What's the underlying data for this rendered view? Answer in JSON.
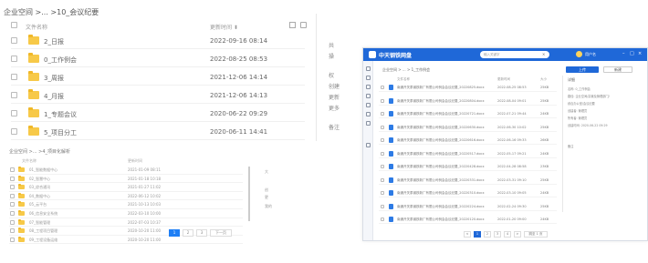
{
  "main": {
    "breadcrumb": "企业空间 >... >10_会议纪要",
    "header": {
      "name": "文件名称",
      "time": "更新时间 ⬍"
    },
    "rows": [
      {
        "name": "2_日报",
        "time": "2022-09-16 08:14"
      },
      {
        "name": "0_工作例会",
        "time": "2022-08-25 08:53"
      },
      {
        "name": "3_周报",
        "time": "2021-12-06 14:14"
      },
      {
        "name": "4_月报",
        "time": "2021-12-06 14:13"
      },
      {
        "name": "1_专题会议",
        "time": "2020-06-22 09:29"
      },
      {
        "name": "5_项目分工",
        "time": "2020-06-11 14:41"
      }
    ],
    "side": [
      "共",
      "操",
      "权",
      "创建",
      "更新",
      "更多",
      "备注"
    ]
  },
  "small": {
    "breadcrumb": "企业空间 >... >4_项目化解析",
    "header": {
      "name": "文件名称",
      "time": "更新时间"
    },
    "rows": [
      {
        "name": "01_智能数据中心",
        "time": "2021-01-09 08:11"
      },
      {
        "name": "02_智慧中心",
        "time": "2021-01-18 10:18"
      },
      {
        "name": "03_综合通讯",
        "time": "2021-01-27 11:02"
      },
      {
        "name": "04_数据中心",
        "time": "2022-06-12 10:02"
      },
      {
        "name": "05_云平台",
        "time": "2021-10-13 10:03"
      },
      {
        "name": "06_信息安全系统",
        "time": "2022-03-10 10:00"
      },
      {
        "name": "07_智能管理",
        "time": "2022-07-03 10:37"
      },
      {
        "name": "08_工程项目管理",
        "time": "2020-10-20 11:00"
      },
      {
        "name": "09_工程设备运维",
        "time": "2020-10-20 11:00"
      }
    ],
    "side": [
      "大",
      "创",
      "更",
      "我的"
    ],
    "pager": {
      "pages": [
        "1",
        "2",
        "3"
      ],
      "next": "下一页"
    }
  },
  "window": {
    "title": "中天钢铁网盘",
    "search_placeholder": "输入关键字",
    "username": "用户名",
    "breadcrumb": "企业空间 > ... > 1_工作例会",
    "upload_label": "上传",
    "new_label": "新建",
    "header": {
      "name": "文件名称",
      "time": "更新时间",
      "size": "大小"
    },
    "files": [
      {
        "name": "南通开关泰钢铁新厂有限公司例会会议纪要_20220825.docx",
        "time": "2022-08-25 08:53",
        "size": "25KB"
      },
      {
        "name": "南通开关泰钢铁新厂有限公司例会会议纪要_20220804.docx",
        "time": "2022-08-04 09:01",
        "size": "25KB"
      },
      {
        "name": "南通开关泰钢铁新厂有限公司例会会议纪要_20220721.docx",
        "time": "2022-07-21 09:44",
        "size": "24KB"
      },
      {
        "name": "南通开关泰钢铁新厂有限公司例会会议纪要_20220630.docx",
        "time": "2022-06-30 10:02",
        "size": "25KB"
      },
      {
        "name": "南通开关泰钢铁新厂有限公司例会会议纪要_20220616.docx",
        "time": "2022-06-16 09:33",
        "size": "26KB"
      },
      {
        "name": "南通开关泰钢铁新厂有限公司例会会议纪要_20220517.docx",
        "time": "2022-05-17 09:21",
        "size": "24KB"
      },
      {
        "name": "南通开关泰钢铁新厂有限公司例会会议纪要_20220428.docx",
        "time": "2022-04-28 08:58",
        "size": "23KB"
      },
      {
        "name": "南通开关泰钢铁新厂有限公司例会会议纪要_20220331.docx",
        "time": "2022-03-31 09:10",
        "size": "25KB"
      },
      {
        "name": "南通开关泰钢铁新厂有限公司例会会议纪要_20220310.docx",
        "time": "2022-03-10 09:05",
        "size": "24KB"
      },
      {
        "name": "南通开关泰钢铁新厂有限公司例会会议纪要_20220224.docx",
        "time": "2022-02-24 09:30",
        "size": "25KB"
      },
      {
        "name": "南通开关泰钢铁新厂有限公司例会会议纪要_20220120.docx",
        "time": "2022-01-20 09:00",
        "size": "24KB"
      }
    ],
    "details": {
      "title": "详细",
      "lines": [
        "名称: 0_工作例会",
        "路径: 企业空间/高管及管理部门/",
        "     综合办公室/会议纪要",
        "创建者: 管理员",
        "所有者: 管理员",
        "创建时间: 2020-06-22 09:29"
      ],
      "remark": "备注"
    },
    "pager": {
      "prev": "<",
      "pages": [
        "1",
        "2",
        "3",
        "4"
      ],
      "next": ">",
      "jump": "跳至 1 页"
    }
  }
}
